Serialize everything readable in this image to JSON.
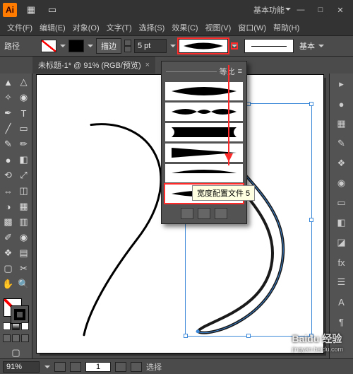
{
  "title": {
    "workspace": "基本功能"
  },
  "menu": [
    "文件(F)",
    "编辑(E)",
    "对象(O)",
    "文字(T)",
    "选择(S)",
    "效果(C)",
    "视图(V)",
    "窗口(W)",
    "帮助(H)"
  ],
  "ctrl": {
    "path_label": "路径",
    "stroke_btn": "描边",
    "stroke_pt": "5 pt",
    "brush_label": "基本"
  },
  "tab": {
    "title": "未标题-1* @ 91% (RGB/预览)"
  },
  "dropdown": {
    "header": "等比",
    "tooltip": "宽度配置文件 5"
  },
  "status": {
    "zoom": "91%",
    "page": "1",
    "mode": "选择"
  },
  "watermark": {
    "brand": "Baidu 经验",
    "url": "jingyan.baidu.com"
  },
  "icons": {
    "min": "—",
    "max": "□",
    "close": "✕",
    "tabx": "×",
    "expand": "▸",
    "menu4": "≡",
    "color": "●",
    "swatch": "▦",
    "brush": "✎",
    "symbol": "❖",
    "stroke": "◉",
    "grad": "▭",
    "trans": "◧",
    "appear": "◪",
    "graphic": "fx",
    "layers": "☰",
    "char": "A",
    "para": "¶"
  }
}
